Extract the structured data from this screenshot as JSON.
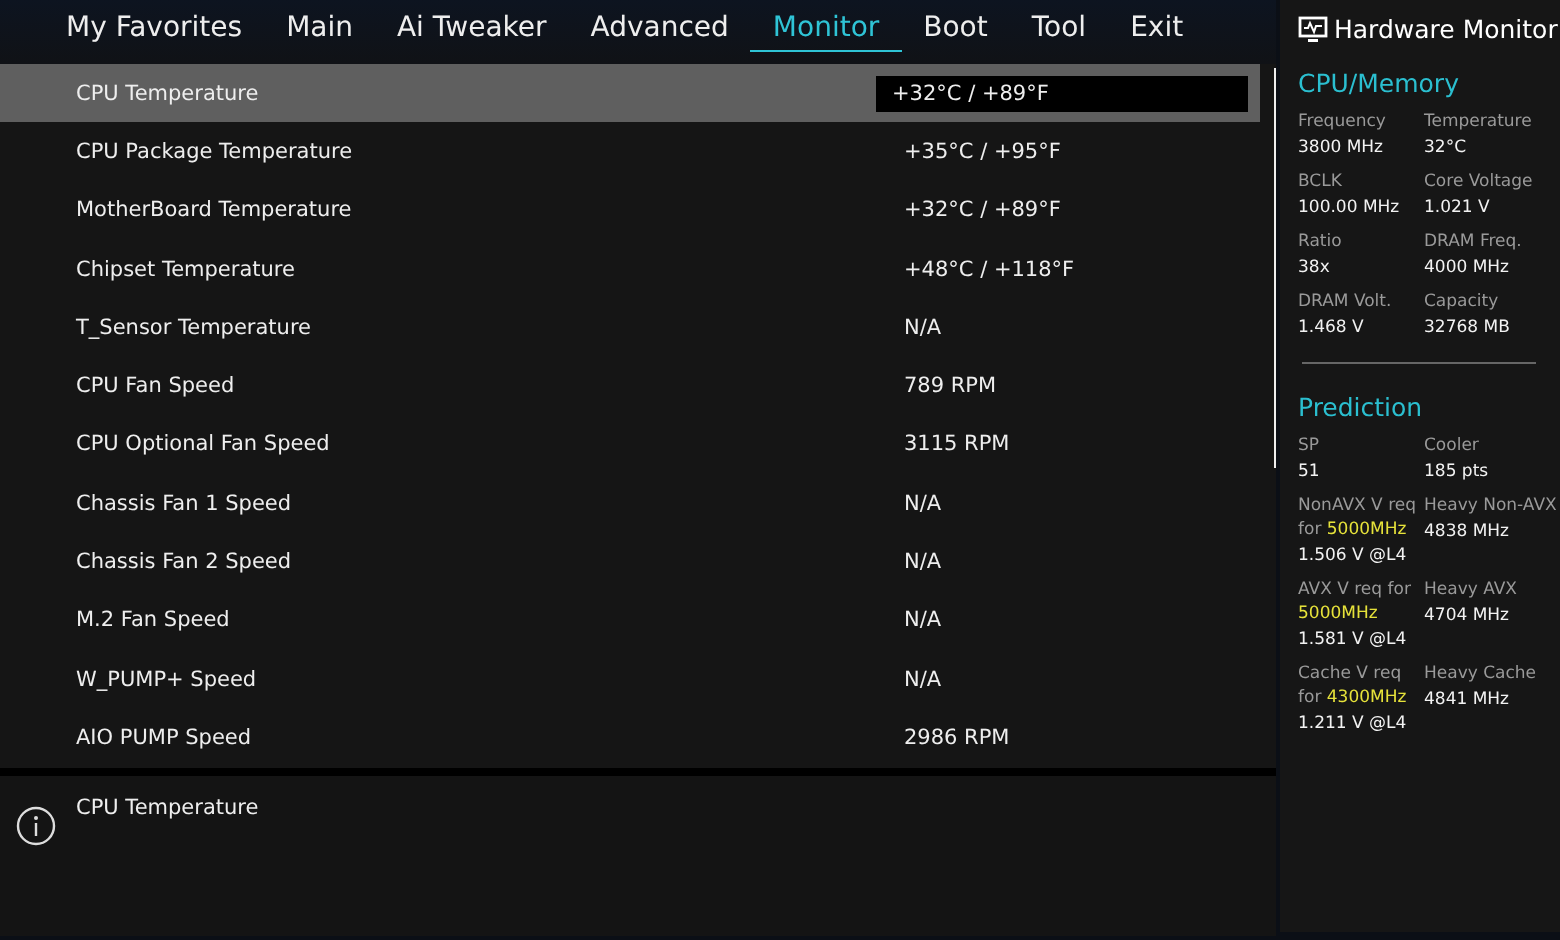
{
  "tabs": [
    {
      "label": "My Favorites",
      "selected": false
    },
    {
      "label": "Main",
      "selected": false
    },
    {
      "label": "Ai Tweaker",
      "selected": false
    },
    {
      "label": "Advanced",
      "selected": false
    },
    {
      "label": "Monitor",
      "selected": true
    },
    {
      "label": "Boot",
      "selected": false
    },
    {
      "label": "Tool",
      "selected": false
    },
    {
      "label": "Exit",
      "selected": false
    }
  ],
  "rows": [
    {
      "label": "CPU Temperature",
      "value": "+32°C / +89°F",
      "selected": true
    },
    {
      "label": "CPU Package Temperature",
      "value": "+35°C / +95°F",
      "selected": false
    },
    {
      "label": "MotherBoard Temperature",
      "value": "+32°C / +89°F",
      "selected": false
    },
    {
      "label": "Chipset Temperature",
      "value": "+48°C / +118°F",
      "selected": false
    },
    {
      "label": "T_Sensor Temperature",
      "value": "N/A",
      "selected": false
    },
    {
      "label": "CPU Fan Speed",
      "value": "789 RPM",
      "selected": false
    },
    {
      "label": "CPU Optional Fan Speed",
      "value": "3115 RPM",
      "selected": false
    },
    {
      "label": "Chassis Fan 1 Speed",
      "value": "N/A",
      "selected": false
    },
    {
      "label": "Chassis Fan 2 Speed",
      "value": "N/A",
      "selected": false
    },
    {
      "label": "M.2 Fan Speed",
      "value": "N/A",
      "selected": false
    },
    {
      "label": "W_PUMP+ Speed",
      "value": "N/A",
      "selected": false
    },
    {
      "label": "AIO PUMP Speed",
      "value": "2986 RPM",
      "selected": false
    }
  ],
  "help": {
    "text": "CPU Temperature"
  },
  "hardware_monitor": {
    "title": "Hardware Monitor",
    "sections": [
      {
        "title": "CPU/Memory",
        "items": [
          {
            "label": "Frequency",
            "value": "3800 MHz"
          },
          {
            "label": "Temperature",
            "value": "32°C"
          },
          {
            "label": "BCLK",
            "value": "100.00 MHz"
          },
          {
            "label": "Core Voltage",
            "value": "1.021 V"
          },
          {
            "label": "Ratio",
            "value": "38x"
          },
          {
            "label": "DRAM Freq.",
            "value": "4000 MHz"
          },
          {
            "label": "DRAM Volt.",
            "value": "1.468 V"
          },
          {
            "label": "Capacity",
            "value": "32768 MB"
          }
        ]
      },
      {
        "title": "Prediction",
        "items": [
          {
            "label": "SP",
            "value": "51"
          },
          {
            "label": "Cooler",
            "value": "185 pts"
          },
          {
            "label": "NonAVX V req for **5000MHz**",
            "value": "1.506 V @L4"
          },
          {
            "label": "Heavy Non-AVX",
            "value": "4838 MHz"
          },
          {
            "label": "AVX V req for **5000MHz**",
            "value": "1.581 V @L4"
          },
          {
            "label": "Heavy AVX",
            "value": "4704 MHz"
          },
          {
            "label": "Cache V req for **4300MHz**",
            "value": "1.211 V @L4"
          },
          {
            "label": "Heavy Cache",
            "value": "4841 MHz"
          }
        ]
      }
    ]
  }
}
